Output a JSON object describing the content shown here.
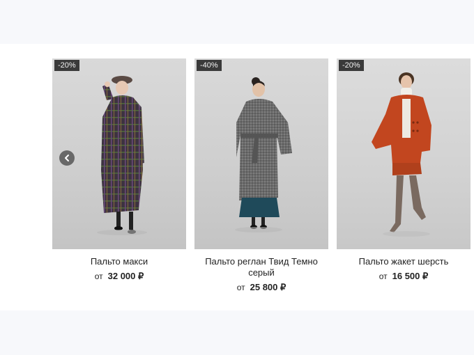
{
  "products": [
    {
      "badge": "-20%",
      "name": "Пальто макси",
      "price_prefix": "от",
      "price": "32 000 ₽"
    },
    {
      "badge": "-40%",
      "name": "Пальто реглан Твид Темно серый",
      "price_prefix": "от",
      "price": "25 800 ₽"
    },
    {
      "badge": "-20%",
      "name": "Пальто жакет шерсть",
      "price_prefix": "от",
      "price": "16 500 ₽"
    }
  ],
  "carousel": {
    "prev_icon": "chevron-left-icon"
  },
  "colors": {
    "badge_bg": "#3a3a3a",
    "page_bg": "#f7f8fb",
    "coat_plaid": "#3d3340",
    "coat_tweed": "#6b6b6b",
    "coat_orange": "#c2461f"
  }
}
